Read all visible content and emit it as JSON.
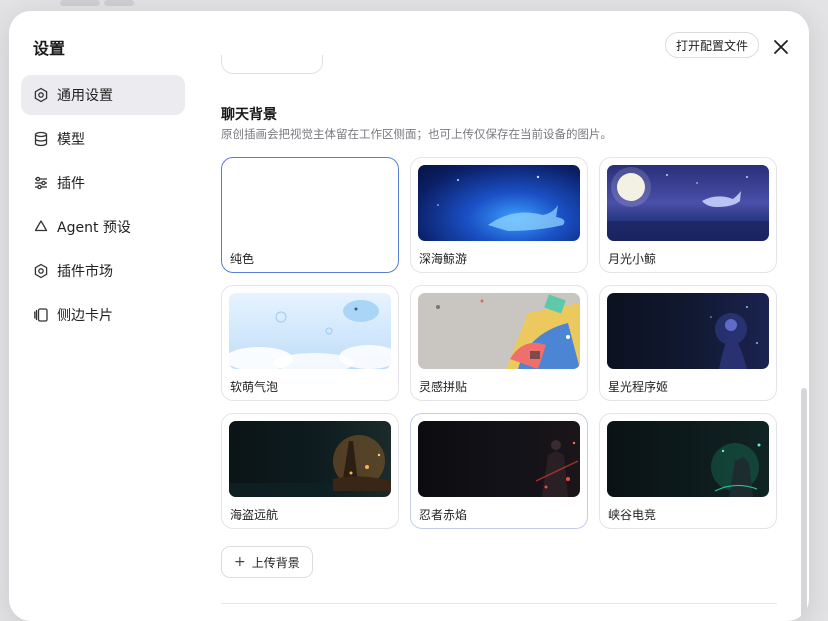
{
  "dialog": {
    "title": "设置",
    "open_config_label": "打开配置文件"
  },
  "sidebar": {
    "items": [
      {
        "label": "通用设置",
        "icon": "gear-icon",
        "active": true
      },
      {
        "label": "模型",
        "icon": "database-icon",
        "active": false
      },
      {
        "label": "插件",
        "icon": "sliders-icon",
        "active": false
      },
      {
        "label": "Agent 预设",
        "icon": "recycle-icon",
        "active": false
      },
      {
        "label": "插件市场",
        "icon": "gear-icon",
        "active": false
      },
      {
        "label": "侧边卡片",
        "icon": "cards-icon",
        "active": false
      }
    ]
  },
  "chat_background": {
    "title": "聊天背景",
    "description": "原创插画会把视觉主体留在工作区侧面；也可上传仅保存在当前设备的图片。",
    "options": [
      {
        "label": "纯色",
        "selected": true
      },
      {
        "label": "深海鲸游",
        "selected": false
      },
      {
        "label": "月光小鲸",
        "selected": false
      },
      {
        "label": "软萌气泡",
        "selected": false
      },
      {
        "label": "灵感拼贴",
        "selected": false
      },
      {
        "label": "星光程序姬",
        "selected": false
      },
      {
        "label": "海盗远航",
        "selected": false
      },
      {
        "label": "忍者赤焰",
        "selected": false
      },
      {
        "label": "峡谷电竞",
        "selected": false
      }
    ],
    "upload_label": "上传背景"
  },
  "colors": {
    "selected_border": "#5b7fd6",
    "active_nav_bg": "#ececf0"
  }
}
